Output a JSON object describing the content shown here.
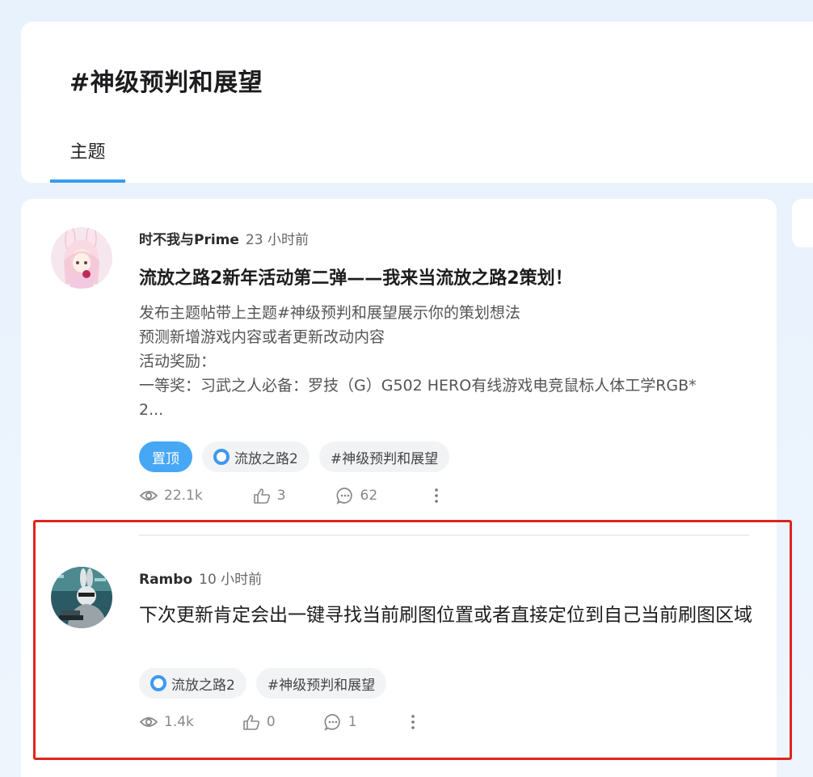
{
  "topic": {
    "title": "#神级预判和展望",
    "tabs": [
      {
        "label": "主题",
        "active": true
      }
    ]
  },
  "posts": [
    {
      "author": "时不我与Prime",
      "time": "23 小时前",
      "title": "流放之路2新年活动第二弹——我来当流放之路2策划！",
      "excerpt": [
        "发布主题帖带上主题#神级预判和展望展示你的策划想法",
        "预测新增游戏内容或者更新改动内容",
        "活动奖励：",
        "一等奖：习武之人必备：罗技（G）G502 HERO有线游戏电竞鼠标人体工学RGB*",
        "2..."
      ],
      "tags": [
        "置顶",
        "流放之路2",
        "#神级预判和展望"
      ],
      "views": "22.1k",
      "likes": "3",
      "comments": "62"
    },
    {
      "author": "Rambo",
      "time": "10 小时前",
      "title": "下次更新肯定会出一键寻找当前刷图位置或者直接定位到自己当前刷图区域",
      "tags": [
        "流放之路2",
        "#神级预判和展望"
      ],
      "views": "1.4k",
      "likes": "0",
      "comments": "1"
    }
  ],
  "colors": {
    "accent": "#3a9bf0",
    "pinned_tag": "#46a7f5",
    "highlight_box": "#e0241e"
  }
}
